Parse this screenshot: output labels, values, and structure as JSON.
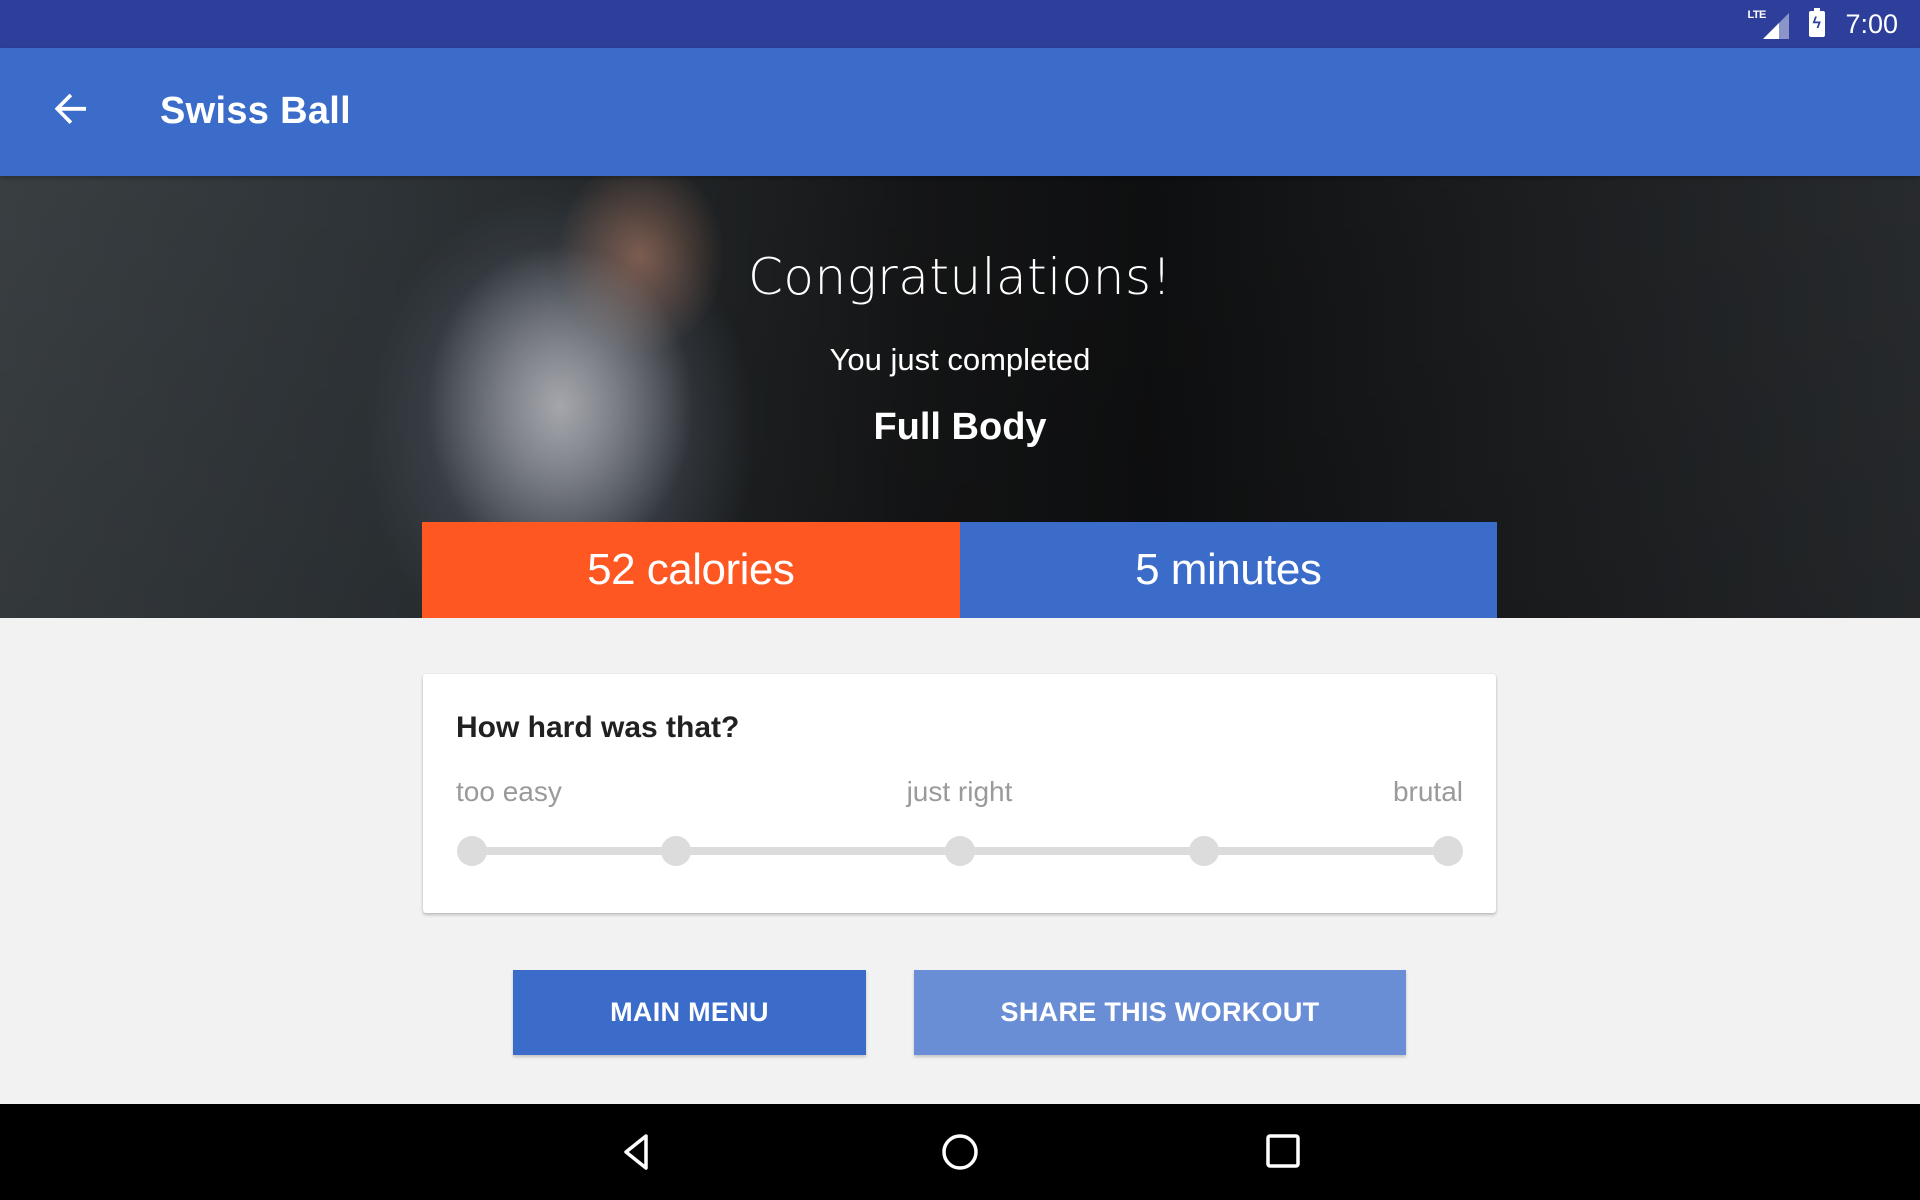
{
  "status_bar": {
    "network": "LTE",
    "time": "7:00"
  },
  "app_bar": {
    "title": "Swiss Ball",
    "back_icon": "arrow-back-icon"
  },
  "hero": {
    "congrats": "Congratulations!",
    "subtitle": "You just completed",
    "workout_name": "Full Body"
  },
  "stats": {
    "calories": "52 calories",
    "minutes": "5 minutes",
    "calories_color": "#ff5722",
    "minutes_color": "#3b6cca"
  },
  "rating": {
    "question": "How hard was that?",
    "labels": {
      "left": "too easy",
      "middle": "just right",
      "right": "brutal"
    },
    "steps": 5,
    "selected": null
  },
  "actions": {
    "main_menu": "MAIN MENU",
    "share": "SHARE THIS WORKOUT"
  },
  "nav_bar": {
    "icons": [
      "back-icon",
      "home-icon",
      "recents-icon"
    ]
  },
  "colors": {
    "status_bar": "#2d3f9b",
    "primary": "#3b6cca",
    "accent": "#ff5722",
    "share_button": "#6a8ed6"
  }
}
